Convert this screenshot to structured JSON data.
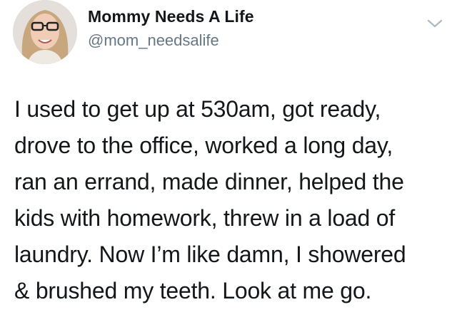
{
  "author": {
    "display_name": "Mommy Needs A Life",
    "handle": "@mom_needsalife",
    "avatar_icon": "profile-photo",
    "menu_icon": "chevron-down-icon"
  },
  "tweet": {
    "lines": [
      "I used to get up at 530am, got ready,",
      "drove to the office, worked a long day,",
      "ran an errand, made dinner, helped the",
      "kids with homework, threw in a load of",
      "laundry. Now I’m like damn, I showered",
      "& brushed my teeth. Look at me go."
    ]
  },
  "colors": {
    "text": "#14171a",
    "secondary": "#657786",
    "caret": "#aab8c2"
  }
}
